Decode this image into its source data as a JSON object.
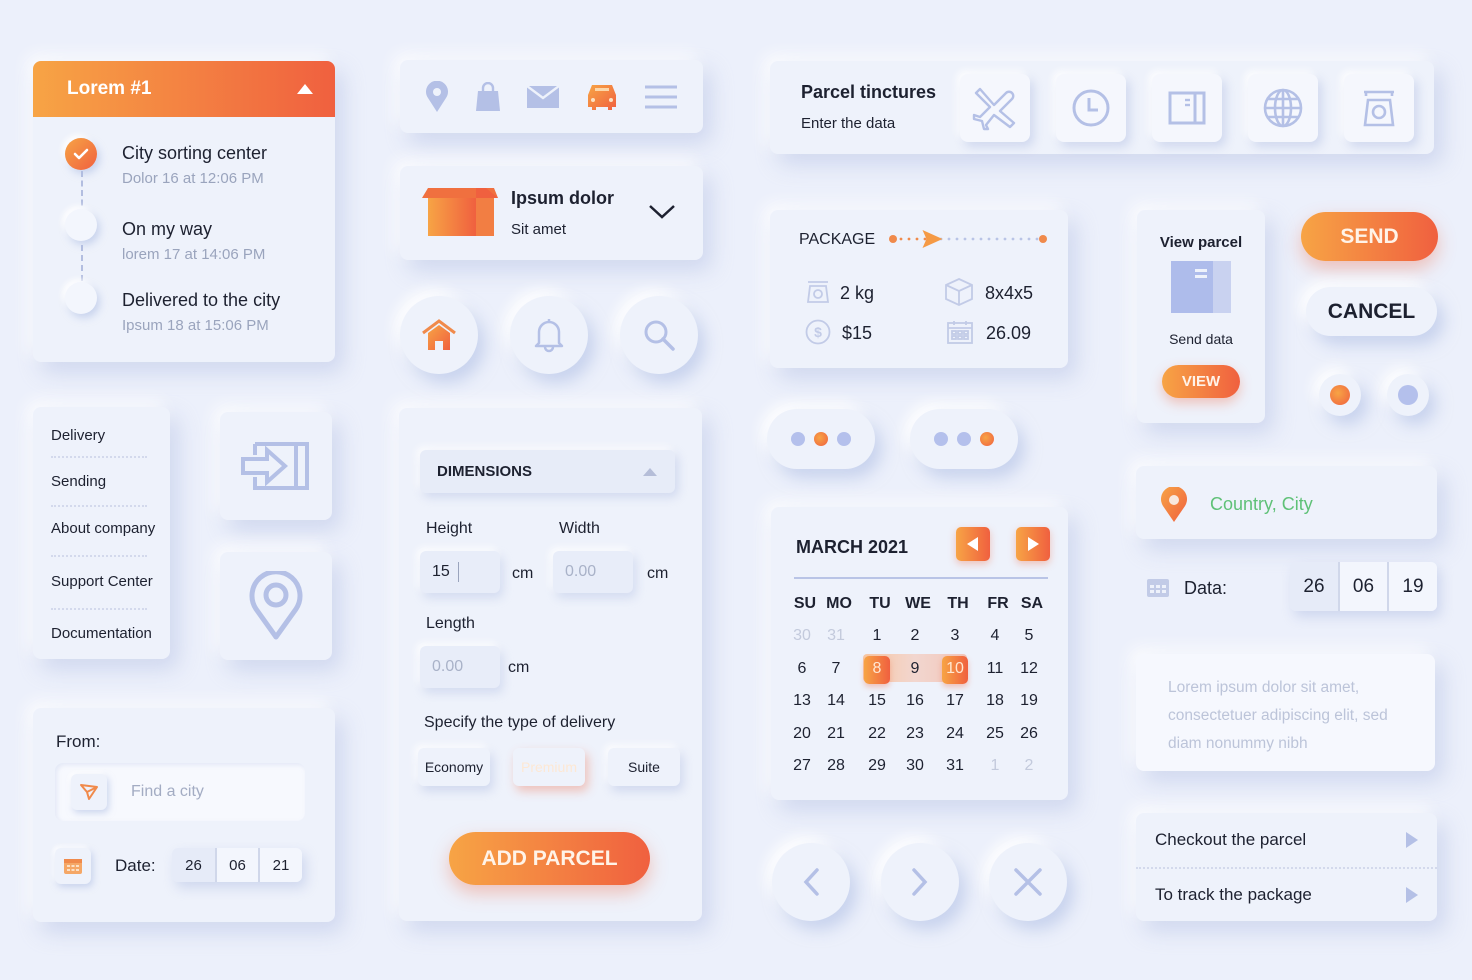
{
  "colors": {
    "background": "#ECF0FB",
    "accent_start": "#F7A445",
    "accent_end": "#F0603F",
    "icon_muted": "#B4C0E6",
    "text_dark": "#1D2130",
    "text_muted": "#9AA4BD",
    "location_text": "#5FC177"
  },
  "timeline": {
    "title": "Lorem #1",
    "toggle_icon": "caret-up-icon",
    "steps": [
      {
        "title": "City sorting center",
        "subtitle": "Dolor 16 at 12:06 PM",
        "status": "done"
      },
      {
        "title": "On my way",
        "subtitle": "lorem 17 at 14:06 PM",
        "status": "pending"
      },
      {
        "title": "Delivered to the city",
        "subtitle": "Ipsum 18 at 15:06 PM",
        "status": "pending"
      }
    ]
  },
  "nav_bar": {
    "icons": [
      "location-pin-icon",
      "shopping-bag-icon",
      "mail-icon",
      "car-icon",
      "hamburger-menu-icon"
    ],
    "active_index": 3
  },
  "dropdown_card": {
    "icon": "open-box-icon",
    "title": "Ipsum dolor",
    "subtitle": "Sit amet",
    "chevron": "chevron-down-icon"
  },
  "round_buttons": {
    "icons": [
      "home-icon",
      "bell-icon",
      "search-icon"
    ],
    "active_index": 0
  },
  "side_menu": {
    "items": [
      "Delivery",
      "Sending",
      "About company",
      "Support Center",
      "Documentation"
    ]
  },
  "icon_tiles": [
    "sign-in-icon",
    "location-pin-outline-icon"
  ],
  "from_card": {
    "label": "From:",
    "search_placeholder": "Find a city",
    "search_icon": "send-arrow-icon",
    "date_label": "Date:",
    "date": {
      "day": "26",
      "month": "06",
      "year": "21"
    },
    "calendar_icon": "calendar-icon"
  },
  "dimensions": {
    "header": "DIMENSIONS",
    "height_label": "Height",
    "height_value": "15",
    "width_label": "Width",
    "width_placeholder": "0.00",
    "length_label": "Length",
    "length_placeholder": "0.00",
    "unit": "cm",
    "delivery_label": "Specify the type of delivery",
    "delivery_options": [
      "Economy",
      "Premium",
      "Suite"
    ],
    "selected_option": "Premium",
    "add_button": "ADD PARCEL"
  },
  "tinctures": {
    "title": "Parcel tinctures",
    "subtitle": "Enter the data",
    "icons": [
      "airplane-icon",
      "clock-icon",
      "parcel-icon",
      "globe-icon",
      "scale-icon"
    ]
  },
  "package": {
    "title": "PACKAGE",
    "progress": 0.25,
    "weight": "2 kg",
    "size": "8x4x5",
    "price": "$15",
    "date": "26.09"
  },
  "view_parcel": {
    "title": "View parcel",
    "caption": "Send data",
    "button": "VIEW"
  },
  "actions": {
    "send": "SEND",
    "cancel": "CANCEL",
    "radio_selected": 0
  },
  "pagers": [
    {
      "active_dot": 1,
      "dots": 3
    },
    {
      "active_dot": 2,
      "dots": 3
    }
  ],
  "calendar": {
    "month_label": "MARCH 2021",
    "weekdays": [
      "SU",
      "MO",
      "TU",
      "WE",
      "TH",
      "FR",
      "SA"
    ],
    "weeks": [
      [
        {
          "d": "30",
          "m": true
        },
        {
          "d": "31",
          "m": true
        },
        {
          "d": "1"
        },
        {
          "d": "2"
        },
        {
          "d": "3"
        },
        {
          "d": "4"
        },
        {
          "d": "5"
        }
      ],
      [
        {
          "d": "6"
        },
        {
          "d": "7"
        },
        {
          "d": "8",
          "s": true
        },
        {
          "d": "9",
          "r": true
        },
        {
          "d": "10",
          "s": true
        },
        {
          "d": "11"
        },
        {
          "d": "12"
        }
      ],
      [
        {
          "d": "13"
        },
        {
          "d": "14"
        },
        {
          "d": "15"
        },
        {
          "d": "16"
        },
        {
          "d": "17"
        },
        {
          "d": "18"
        },
        {
          "d": "19"
        }
      ],
      [
        {
          "d": "20"
        },
        {
          "d": "21"
        },
        {
          "d": "22"
        },
        {
          "d": "23"
        },
        {
          "d": "24"
        },
        {
          "d": "25"
        },
        {
          "d": "26"
        }
      ],
      [
        {
          "d": "27"
        },
        {
          "d": "28"
        },
        {
          "d": "29"
        },
        {
          "d": "30"
        },
        {
          "d": "31"
        },
        {
          "d": "1",
          "m": true
        },
        {
          "d": "2",
          "m": true
        }
      ]
    ],
    "range": [
      "8",
      "10"
    ]
  },
  "nav_circles": [
    "chevron-left-icon",
    "chevron-right-icon",
    "close-icon"
  ],
  "location": {
    "text": "Country, City",
    "icon": "location-pin-icon"
  },
  "data_row": {
    "label": "Data:",
    "date": {
      "day": "26",
      "month": "06",
      "year": "19"
    }
  },
  "textarea": {
    "placeholder": "Lorem ipsum dolor sit amet, consectetuer adipiscing elit, sed diam nonummy nibh"
  },
  "links": [
    "Checkout the parcel",
    "To track the package"
  ]
}
